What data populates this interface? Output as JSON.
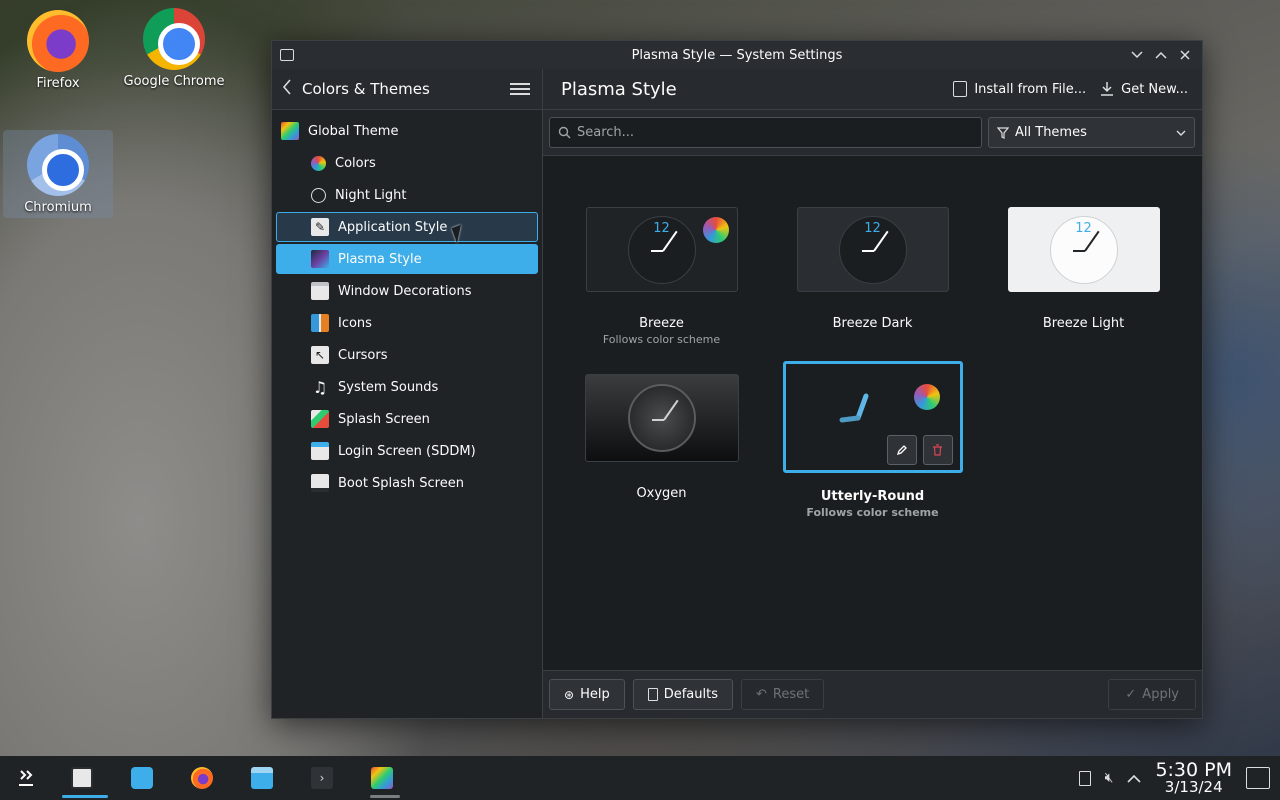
{
  "desktop": {
    "icons": [
      {
        "label": "Firefox"
      },
      {
        "label": "Google Chrome"
      },
      {
        "label": "Chromium"
      }
    ]
  },
  "window": {
    "title": "Plasma Style — System Settings"
  },
  "sidebar": {
    "title": "Colors & Themes",
    "items": [
      {
        "label": "Global Theme",
        "icon": "global-theme-icon"
      },
      {
        "label": "Colors",
        "icon": "colors-icon"
      },
      {
        "label": "Night Light",
        "icon": "night-light-icon"
      },
      {
        "label": "Application Style",
        "icon": "application-style-icon"
      },
      {
        "label": "Plasma Style",
        "icon": "plasma-style-icon"
      },
      {
        "label": "Window Decorations",
        "icon": "window-decorations-icon"
      },
      {
        "label": "Icons",
        "icon": "icons-icon"
      },
      {
        "label": "Cursors",
        "icon": "cursors-icon"
      },
      {
        "label": "System Sounds",
        "icon": "music-note-icon"
      },
      {
        "label": "Splash Screen",
        "icon": "splash-screen-icon"
      },
      {
        "label": "Login Screen (SDDM)",
        "icon": "login-screen-icon"
      },
      {
        "label": "Boot Splash Screen",
        "icon": "boot-splash-icon"
      }
    ]
  },
  "main": {
    "title": "Plasma Style",
    "install_label": "Install from File...",
    "get_new_label": "Get New...",
    "search_placeholder": "Search...",
    "filter_value": "All Themes",
    "themes": [
      {
        "name": "Breeze",
        "subtitle": "Follows color scheme",
        "clock_number": "12"
      },
      {
        "name": "Breeze Dark",
        "subtitle": "",
        "clock_number": "12"
      },
      {
        "name": "Breeze Light",
        "subtitle": "",
        "clock_number": "12"
      },
      {
        "name": "Oxygen",
        "subtitle": ""
      },
      {
        "name": "Utterly-Round",
        "subtitle": "Follows color scheme"
      }
    ]
  },
  "footer": {
    "help_label": "Help",
    "defaults_label": "Defaults",
    "reset_label": "Reset",
    "apply_label": "Apply"
  },
  "taskbar": {
    "time": "5:30 PM",
    "date": "3/13/24"
  },
  "colors": {
    "accent": "#3daee9",
    "window_bg": "#202326"
  }
}
